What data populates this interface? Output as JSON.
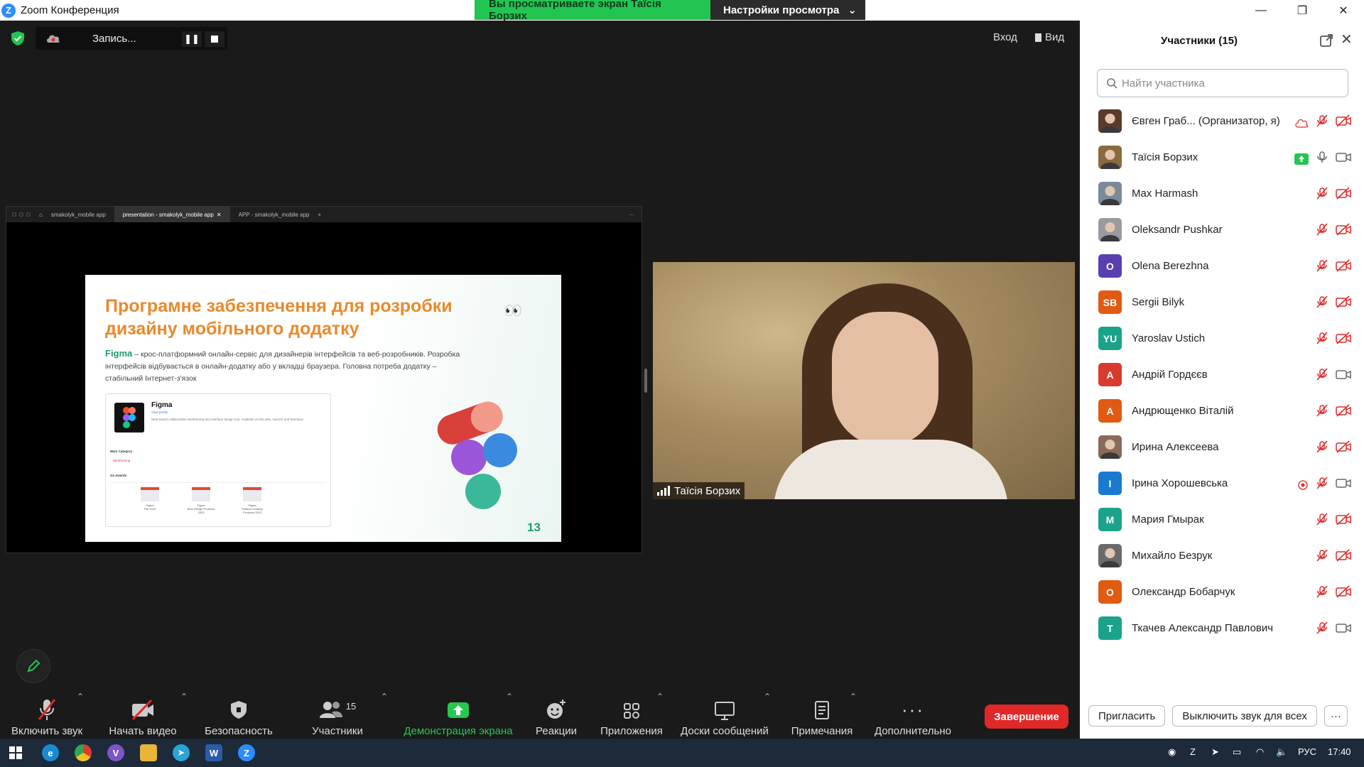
{
  "window": {
    "title": "Zoom Конференция"
  },
  "share_banner": {
    "text": "Вы просматриваете экран Таїсія Борзих",
    "options_label": "Настройки просмотра"
  },
  "recording": {
    "label": "Запись..."
  },
  "top_right": {
    "enter_label": "Вход",
    "view_label": "Вид"
  },
  "browser_tabs": [
    {
      "label": "smakolyk_mobile app"
    },
    {
      "label": "presentation - smakolyk_mobile app"
    },
    {
      "label": "APP - smakolyk_mobile app"
    }
  ],
  "slide": {
    "title": "Програмне забезпечення для розробки дизайну мобільного додатку",
    "brand": "Figma",
    "description": " – крос-платформний онлайн-сервіс для дизайнерів інтерфейсів та веб-розробників. Розробка інтерфейсів відбувається в онлайн-додатку або у вкладці браузера. Головна потреба додатку – стабільний Інтернет-з'язок",
    "card_name": "Figma",
    "card_view_profile": "View profile",
    "card_summary": "Web-based collaborative wireframing and interface design tool. Available on the web, macOS and Windows.",
    "main_category_label": "Main Category",
    "category": "Wireframing",
    "awards_label": "G2 Awards",
    "awards": [
      {
        "line1": "Figma",
        "line2": "Fall 2023"
      },
      {
        "line1": "Figma",
        "line2": "Best Design Products 2023"
      },
      {
        "line1": "Figma",
        "line2": "Fastest Growing Products 2023"
      }
    ],
    "page_number": "13"
  },
  "video": {
    "name": "Таїсія Борзих"
  },
  "toolbar": {
    "unmute": "Включить звук",
    "start_video": "Начать видео",
    "security": "Безопасность",
    "participants": "Участники",
    "participants_count": "15",
    "share": "Демонстрация экрана",
    "reactions": "Реакции",
    "apps": "Приложения",
    "whiteboards": "Доски сообщений",
    "notes": "Примечания",
    "more": "Дополнительно",
    "end": "Завершение"
  },
  "panel": {
    "title": "Участники (15)",
    "search_placeholder": "Найти участника",
    "invite": "Пригласить",
    "mute_all": "Выключить звук для всех",
    "more": "···",
    "participants": [
      {
        "name": "Євген Граб...  (Организатор, я)",
        "initials": "",
        "color": "#5a3a2a",
        "photo": true,
        "mic": "muted",
        "video": "off",
        "extra": "cloud"
      },
      {
        "name": "Таїсія Борзих",
        "initials": "",
        "color": "#8a6a40",
        "photo": true,
        "mic": "on",
        "video": "on",
        "extra": "share"
      },
      {
        "name": "Max Harmash",
        "initials": "",
        "color": "#7a8a9a",
        "photo": true,
        "mic": "muted",
        "video": "off",
        "extra": ""
      },
      {
        "name": "Oleksandr Pushkar",
        "initials": "",
        "color": "#9a9aa0",
        "photo": true,
        "mic": "muted",
        "video": "off",
        "extra": ""
      },
      {
        "name": "Olena Berezhna",
        "initials": "O",
        "color": "#5b3fb0",
        "photo": false,
        "mic": "muted",
        "video": "off",
        "extra": ""
      },
      {
        "name": "Sergii Bilyk",
        "initials": "SB",
        "color": "#e05a12",
        "photo": false,
        "mic": "muted",
        "video": "off",
        "extra": ""
      },
      {
        "name": "Yaroslav Ustich",
        "initials": "YU",
        "color": "#1aa38a",
        "photo": false,
        "mic": "muted",
        "video": "off",
        "extra": ""
      },
      {
        "name": "Андрій Гордєєв",
        "initials": "А",
        "color": "#d83a2e",
        "photo": false,
        "mic": "muted",
        "video": "on",
        "extra": ""
      },
      {
        "name": "Андрющенко Віталій",
        "initials": "А",
        "color": "#e05a12",
        "photo": false,
        "mic": "muted",
        "video": "off",
        "extra": ""
      },
      {
        "name": "Ирина Алексеева",
        "initials": "",
        "color": "#8a6a5a",
        "photo": true,
        "mic": "muted",
        "video": "off",
        "extra": ""
      },
      {
        "name": "Ірина Хорошевська",
        "initials": "І",
        "color": "#1a7ad0",
        "photo": false,
        "mic": "muted",
        "video": "on",
        "extra": "record"
      },
      {
        "name": "Мария Гмырак",
        "initials": "М",
        "color": "#1aa38a",
        "photo": false,
        "mic": "muted",
        "video": "off",
        "extra": ""
      },
      {
        "name": "Михайло Безрук",
        "initials": "",
        "color": "#6a6a6a",
        "photo": true,
        "mic": "muted",
        "video": "off",
        "extra": ""
      },
      {
        "name": "Олександр Бобарчук",
        "initials": "О",
        "color": "#e05a12",
        "photo": false,
        "mic": "muted",
        "video": "off",
        "extra": ""
      },
      {
        "name": "Ткачев Александр Павлович",
        "initials": "Т",
        "color": "#1aa38a",
        "photo": false,
        "mic": "muted",
        "video": "on",
        "extra": ""
      }
    ]
  },
  "taskbar": {
    "lang": "РУС",
    "time": "17:40"
  }
}
